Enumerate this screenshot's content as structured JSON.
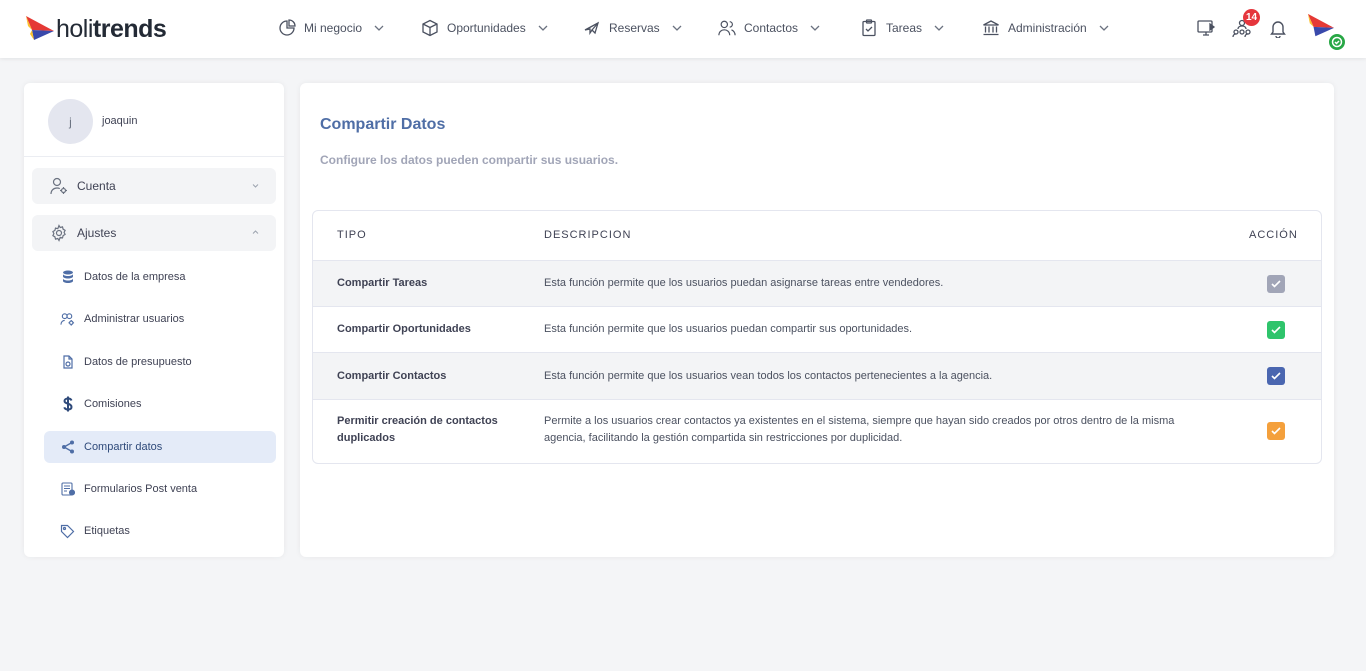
{
  "brand": {
    "light": "holi",
    "bold": "trends"
  },
  "nav": [
    {
      "label": "Mi negocio",
      "icon": "pie-chart-icon"
    },
    {
      "label": "Oportunidades",
      "icon": "box-icon"
    },
    {
      "label": "Reservas",
      "icon": "plane-icon"
    },
    {
      "label": "Contactos",
      "icon": "users-icon"
    },
    {
      "label": "Tareas",
      "icon": "clipboard-check-icon"
    },
    {
      "label": "Administración",
      "icon": "bank-icon"
    }
  ],
  "top_icons": {
    "notifications_badge": "14"
  },
  "sidebar": {
    "user": {
      "initial": "j",
      "name": "joaquin"
    },
    "groups": [
      {
        "label": "Cuenta",
        "icon": "user-gear-icon",
        "expanded": false
      },
      {
        "label": "Ajustes",
        "icon": "gear-icon",
        "expanded": true
      }
    ],
    "items": [
      {
        "label": "Datos de la empresa",
        "icon": "database-icon"
      },
      {
        "label": "Administrar usuarios",
        "icon": "users-gear-icon"
      },
      {
        "label": "Datos de presupuesto",
        "icon": "document-money-icon"
      },
      {
        "label": "Comisiones",
        "icon": "dollar-icon"
      },
      {
        "label": "Compartir datos",
        "icon": "share-icon",
        "active": true
      },
      {
        "label": "Formularios Post venta",
        "icon": "form-icon"
      },
      {
        "label": "Etiquetas",
        "icon": "tag-icon"
      }
    ]
  },
  "main": {
    "title": "Compartir Datos",
    "subtitle": "Configure los datos pueden compartir sus usuarios.",
    "columns": {
      "tipo": "TIPO",
      "descripcion": "DESCRIPCION",
      "accion": "ACCIÓN"
    },
    "rows": [
      {
        "tipo": "Compartir Tareas",
        "descripcion": "Esta función permite que los usuarios puedan asignarse tareas entre vendedores.",
        "checked": true,
        "color": "#a1a5b7"
      },
      {
        "tipo": "Compartir Oportunidades",
        "descripcion": "Esta función permite que los usuarios puedan compartir sus oportunidades.",
        "checked": true,
        "color": "#2ec46b"
      },
      {
        "tipo": "Compartir Contactos",
        "descripcion": "Esta función permite que los usuarios vean todos los contactos pertenecientes a la agencia.",
        "checked": true,
        "color": "#4a66b0"
      },
      {
        "tipo": "Permitir creación de contactos duplicados",
        "descripcion": "Permite a los usuarios crear contactos ya existentes en el sistema, siempre que hayan sido creados por otros dentro de la misma agencia, facilitando la gestión compartida sin restricciones por duplicidad.",
        "checked": true,
        "color": "#f4a03c"
      }
    ]
  },
  "colors": {
    "accent": "#4f6ea6",
    "badge": "#e5363d",
    "active_item_bg": "#e4ebf8"
  }
}
